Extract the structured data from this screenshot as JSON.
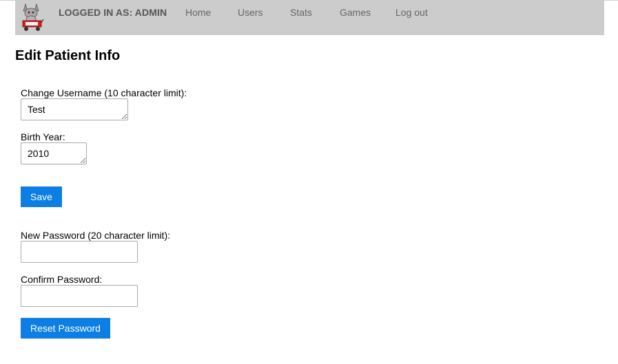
{
  "header": {
    "logo_icon": "kitty-wagon-logo-icon",
    "logged_in_text": "LOGGED IN AS: ADMIN",
    "nav": [
      {
        "label": "Home"
      },
      {
        "label": "Users"
      },
      {
        "label": "Stats"
      },
      {
        "label": "Games"
      },
      {
        "label": "Log out"
      }
    ]
  },
  "page": {
    "title": "Edit Patient Info"
  },
  "form": {
    "username_label": "Change Username (10 character limit):",
    "username_value": "Test",
    "birth_year_label": "Birth Year:",
    "birth_year_value": "2010",
    "save_label": "Save",
    "new_password_label": "New Password (20 character limit):",
    "new_password_value": "",
    "confirm_password_label": "Confirm Password:",
    "confirm_password_value": "",
    "reset_label": "Reset Password"
  },
  "colors": {
    "navbar_bg": "#cccccc",
    "button_bg": "#0c7ee4",
    "button_text": "#ffffff"
  }
}
